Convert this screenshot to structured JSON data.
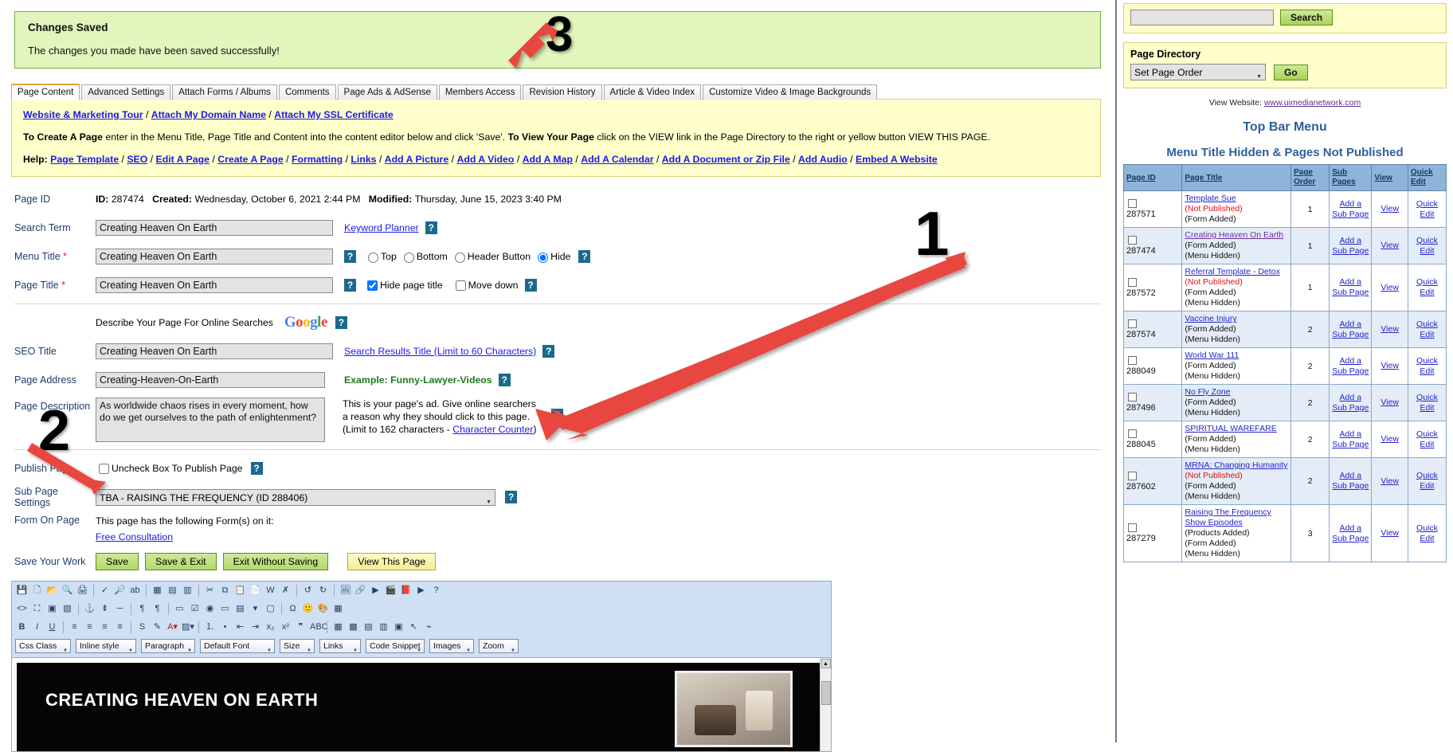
{
  "notice": {
    "title": "Changes Saved",
    "message": "The changes you made have been saved successfully!"
  },
  "tabs": [
    {
      "label": "Page Content",
      "active": true
    },
    {
      "label": "Advanced Settings",
      "active": false
    },
    {
      "label": "Attach Forms / Albums",
      "active": false
    },
    {
      "label": "Comments",
      "active": false
    },
    {
      "label": "Page Ads & AdSense",
      "active": false
    },
    {
      "label": "Members Access",
      "active": false
    },
    {
      "label": "Revision History",
      "active": false
    },
    {
      "label": "Article & Video Index",
      "active": false
    },
    {
      "label": "Customize Video & Image Backgrounds",
      "active": false
    }
  ],
  "help": {
    "top_links": [
      "Website & Marketing Tour",
      "Attach My Domain Name",
      "Attach My SSL Certificate"
    ],
    "sep": " / ",
    "instructions_1": "To Create A Page",
    "instructions_2": " enter in the Menu Title, Page Title and Content into the content editor below and click 'Save'. ",
    "instructions_3": "To View Your Page",
    "instructions_4": " click on the VIEW link in the Page Directory to the right or yellow button VIEW THIS PAGE.",
    "help_prefix": "Help:",
    "help_links": [
      "Page Template",
      "SEO",
      "Edit A Page",
      "Create A Page",
      "Formatting",
      "Links",
      "Add A Picture",
      "Add A Video",
      "Add A Map",
      "Add A Calendar",
      "Add A Document or Zip File",
      "Add Audio",
      "Embed A Website"
    ]
  },
  "form": {
    "page_id_label": "Page ID",
    "id_key": "ID:",
    "id_value": "287474",
    "created_key": "Created:",
    "created_value": "Wednesday, October 6, 2021 2:44 PM",
    "modified_key": "Modified:",
    "modified_value": "Thursday, June 15, 2023 3:40 PM",
    "search_term_label": "Search Term",
    "search_term_value": "Creating Heaven On Earth",
    "keyword_planner_link": "Keyword Planner",
    "menu_title_label": "Menu Title",
    "menu_title_value": "Creating Heaven On Earth",
    "menu_position_options": [
      "Top",
      "Bottom",
      "Header Button",
      "Hide"
    ],
    "menu_position_selected": "Hide",
    "page_title_label": "Page Title",
    "page_title_value": "Creating Heaven On Earth",
    "hide_page_title_label": "Hide page title",
    "hide_page_title_checked": true,
    "move_down_label": "Move down",
    "move_down_checked": false,
    "seo_heading": "Describe Your Page For Online Searches",
    "google_logo": "Google",
    "seo_title_label": "SEO Title",
    "seo_title_value": "Creating Heaven On Earth",
    "seo_title_hint": "Search Results Title (Limit to 60 Characters)",
    "page_address_label": "Page Address",
    "page_address_value": "Creating-Heaven-On-Earth",
    "page_address_hint": "Example: Funny-Lawyer-Videos",
    "page_description_label": "Page Description",
    "page_description_value": "As worldwide chaos rises in every moment, how do we get ourselves to the path of enlightenment?",
    "page_description_hint_1": "This is your page's ad. Give online searchers a reason why they should click to this page.",
    "page_description_hint_2": "(Limit to 162 characters - ",
    "page_description_hint_link": "Character Counter",
    "page_description_hint_3": ")",
    "publish_label": "Publish Page",
    "publish_checkbox_label": "Uncheck Box To Publish Page",
    "publish_checked": false,
    "sub_page_label": "Sub Page Settings",
    "sub_page_selected": "TBA - RAISING THE FREQUENCY (ID 288406)",
    "form_on_page_label": "Form On Page",
    "form_on_page_text": "This page has the following Form(s) on it:",
    "form_on_page_link": "Free Consultation",
    "save_label": "Save Your Work",
    "buttons": {
      "save": "Save",
      "save_exit": "Save & Exit",
      "exit_no_save": "Exit Without Saving",
      "view_page": "View This Page"
    }
  },
  "editor": {
    "dropdowns": [
      {
        "label": "Css Class"
      },
      {
        "label": "Inline style"
      },
      {
        "label": "Paragraph"
      },
      {
        "label": "Default Font"
      },
      {
        "label": "Size"
      },
      {
        "label": "Links"
      },
      {
        "label": "Code Snippet"
      },
      {
        "label": "Images"
      },
      {
        "label": "Zoom"
      }
    ],
    "content_heading": "CREATING HEAVEN ON EARTH"
  },
  "sidebar": {
    "search_button": "Search",
    "page_directory_label": "Page Directory",
    "set_page_order": "Set Page Order",
    "go_button": "Go",
    "view_website_text": "View Website:",
    "view_website_link": "www.uimedianetwork.com",
    "top_bar_menu": "Top Bar Menu",
    "hidden_heading": "Menu Title Hidden & Pages Not Published",
    "table_headers": [
      "Page ID",
      "Page Title",
      "Page Order",
      "Sub Pages",
      "View",
      "Quick Edit"
    ],
    "rows": [
      {
        "id": "287571",
        "title": "Template Sue",
        "not_published": "(Not Published)",
        "meta": [
          "(Form Added)"
        ],
        "order": "1",
        "sub": "Add a Sub Page",
        "view": "View",
        "quick": "Quick Edit",
        "visited": false
      },
      {
        "id": "287474",
        "title": "Creating Heaven On Earth",
        "not_published": "",
        "meta": [
          "(Form Added)",
          "(Menu Hidden)"
        ],
        "order": "1",
        "sub": "Add a Sub Page",
        "view": "View",
        "quick": "Quick Edit",
        "visited": true
      },
      {
        "id": "287572",
        "title": "Referral Template - Detox",
        "not_published": "(Not Published)",
        "meta": [
          "(Form Added)",
          "(Menu Hidden)"
        ],
        "order": "1",
        "sub": "Add a Sub Page",
        "view": "View",
        "quick": "Quick Edit",
        "visited": false
      },
      {
        "id": "287574",
        "title": "Vaccine Injury",
        "not_published": "",
        "meta": [
          "(Form Added)",
          "(Menu Hidden)"
        ],
        "order": "2",
        "sub": "Add a Sub Page",
        "view": "View",
        "quick": "Quick Edit",
        "visited": false
      },
      {
        "id": "288049",
        "title": "World War 111",
        "not_published": "",
        "meta": [
          "(Form Added)",
          "(Menu Hidden)"
        ],
        "order": "2",
        "sub": "Add a Sub Page",
        "view": "View",
        "quick": "Quick Edit",
        "visited": false
      },
      {
        "id": "287496",
        "title": "No Fly Zone",
        "not_published": "",
        "meta": [
          "(Form Added)",
          "(Menu Hidden)"
        ],
        "order": "2",
        "sub": "Add a Sub Page",
        "view": "View",
        "quick": "Quick Edit",
        "visited": false
      },
      {
        "id": "288045",
        "title": "SPIRITUAL WAREFARE",
        "not_published": "",
        "meta": [
          "(Form Added)",
          "(Menu Hidden)"
        ],
        "order": "2",
        "sub": "Add a Sub Page",
        "view": "View",
        "quick": "Quick Edit",
        "visited": false
      },
      {
        "id": "287602",
        "title": "MRNA: Changing Humanity",
        "not_published": "(Not Published)",
        "meta": [
          "(Form Added)",
          "(Menu Hidden)"
        ],
        "order": "2",
        "sub": "Add a Sub Page",
        "view": "View",
        "quick": "Quick Edit",
        "visited": false
      },
      {
        "id": "287279",
        "title": "Raising The Frequency Show Episodes",
        "not_published": "",
        "meta": [
          "(Products Added)",
          "(Form Added)",
          "(Menu Hidden)"
        ],
        "order": "3",
        "sub": "Add a Sub Page",
        "view": "View",
        "quick": "Quick Edit",
        "visited": false
      }
    ]
  },
  "annotations": [
    {
      "label": "1"
    },
    {
      "label": "2"
    },
    {
      "label": "3"
    }
  ]
}
